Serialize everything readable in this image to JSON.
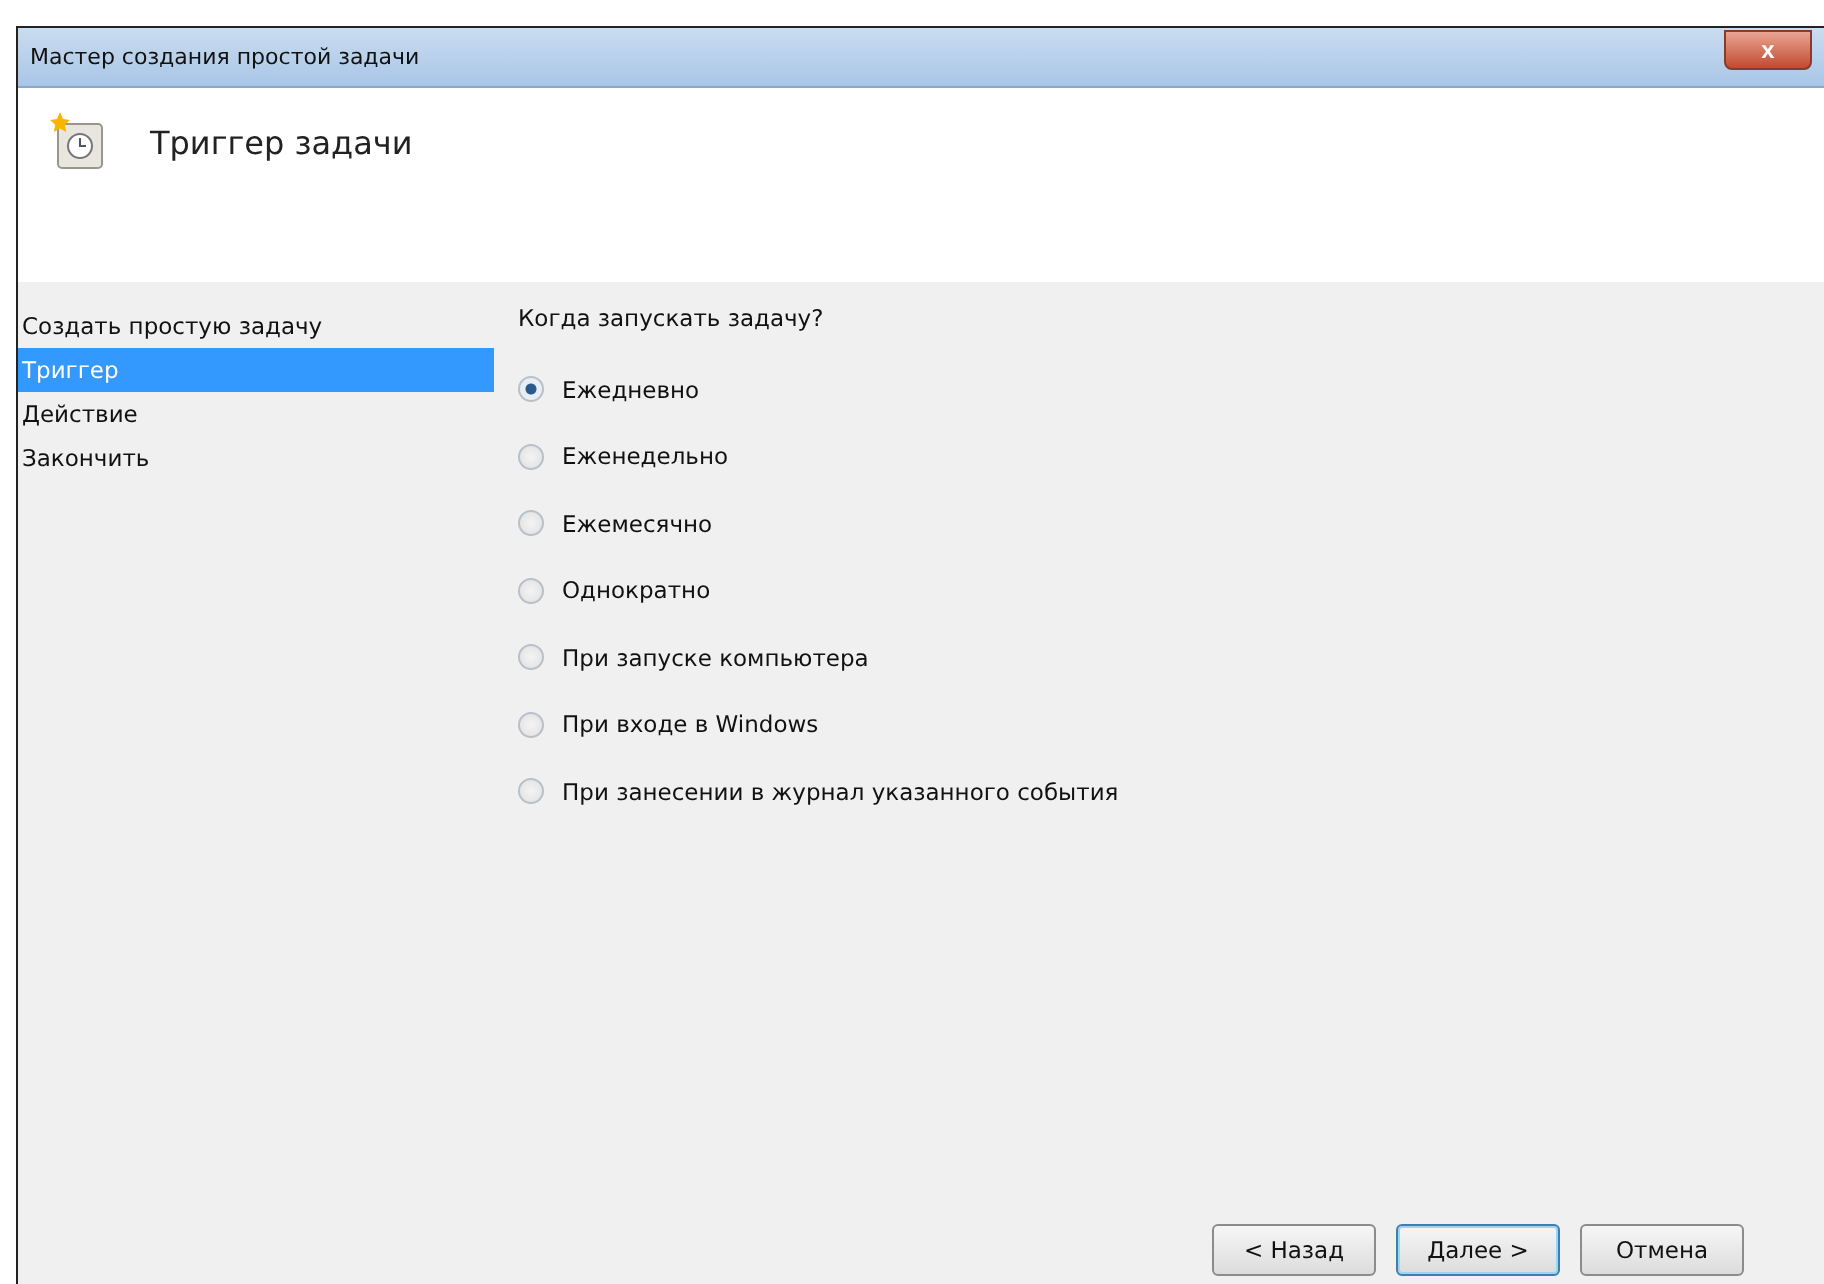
{
  "window": {
    "title": "Мастер создания простой задачи",
    "close": "x"
  },
  "header": {
    "title": "Триггер задачи"
  },
  "sidebar": {
    "items": [
      {
        "label": "Создать простую задачу",
        "selected": false
      },
      {
        "label": "Триггер",
        "selected": true
      },
      {
        "label": "Действие",
        "selected": false
      },
      {
        "label": "Закончить",
        "selected": false
      }
    ]
  },
  "question": "Когда запускать задачу?",
  "options": [
    {
      "label": "Ежедневно",
      "selected": true
    },
    {
      "label": "Еженедельно",
      "selected": false
    },
    {
      "label": "Ежемесячно",
      "selected": false
    },
    {
      "label": "Однократно",
      "selected": false
    },
    {
      "label": "При запуске компьютера",
      "selected": false
    },
    {
      "label": "При входе в Windows",
      "selected": false
    },
    {
      "label": "При занесении в журнал указанного события",
      "selected": false
    }
  ],
  "buttons": [
    {
      "label": "< Назад",
      "default": false
    },
    {
      "label": "Далее >",
      "default": true
    },
    {
      "label": "Отмена",
      "default": false
    }
  ]
}
